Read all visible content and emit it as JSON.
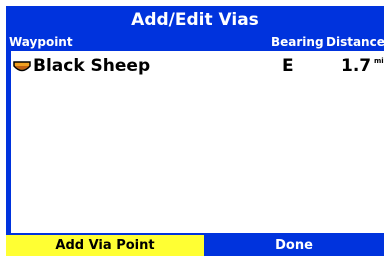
{
  "window": {
    "title": "Add/Edit Vias"
  },
  "columns": {
    "waypoint": "Waypoint",
    "bearing": "Bearing",
    "distance": "Distance"
  },
  "rows": [
    {
      "icon": "waypoint-flag-icon",
      "name": "Black Sheep",
      "bearing": "E",
      "distance": "1.7",
      "unit": "mi"
    }
  ],
  "buttons": {
    "add_via_point": "Add Via Point",
    "done": "Done"
  },
  "colors": {
    "background": "#0033dd",
    "list_background": "#ffffff",
    "selected_button": "#ffff33",
    "text_light": "#ffffff",
    "text_dark": "#000000"
  }
}
